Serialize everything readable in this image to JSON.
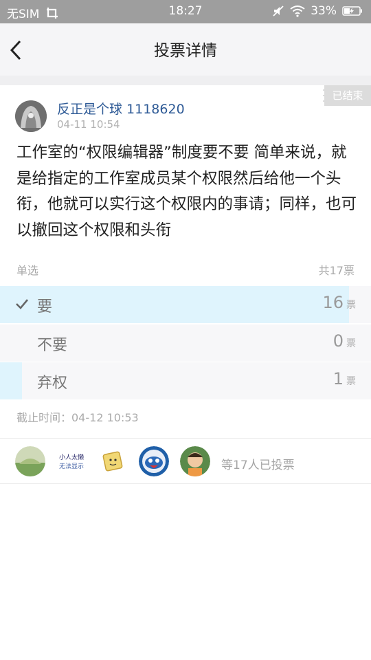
{
  "status": {
    "carrier": "无SIM",
    "time": "18:27",
    "battery": "33%"
  },
  "nav": {
    "title": "投票详情",
    "back_icon": "chevron-left-icon"
  },
  "post": {
    "badge": "已结束",
    "username": "反正是个球 1118620",
    "time": "04-11 10:54",
    "content": "工作室的“权限编辑器”制度要不要 简单来说，就是给指定的工作室成员某个权限然后给他一个头衔，他就可以实行这个权限内的事请；同样，也可以撤回这个权限和头衔"
  },
  "vote": {
    "type": "单选",
    "total": "共17票",
    "unit": "票",
    "options": [
      {
        "label": "要",
        "count": "16",
        "fraction": 0.94,
        "selected": true
      },
      {
        "label": "不要",
        "count": "0",
        "fraction": 0.0,
        "selected": false
      },
      {
        "label": "弃权",
        "count": "1",
        "fraction": 0.06,
        "selected": false
      }
    ],
    "deadline": "截止时间：04-12 10:53"
  },
  "voters": {
    "summary": "等17人已投票",
    "avatar_text": [
      "小人太懒",
      "无法显示"
    ],
    "avatar_colors": [
      "#7aa35a",
      "#2a2a6a",
      "#e7c75a",
      "#1f5fa8",
      "#5a8a4a"
    ]
  },
  "colors": {
    "link": "#2e5a96",
    "bar_fill": "#dff4fd",
    "option_bg": "#f7f7f9"
  }
}
